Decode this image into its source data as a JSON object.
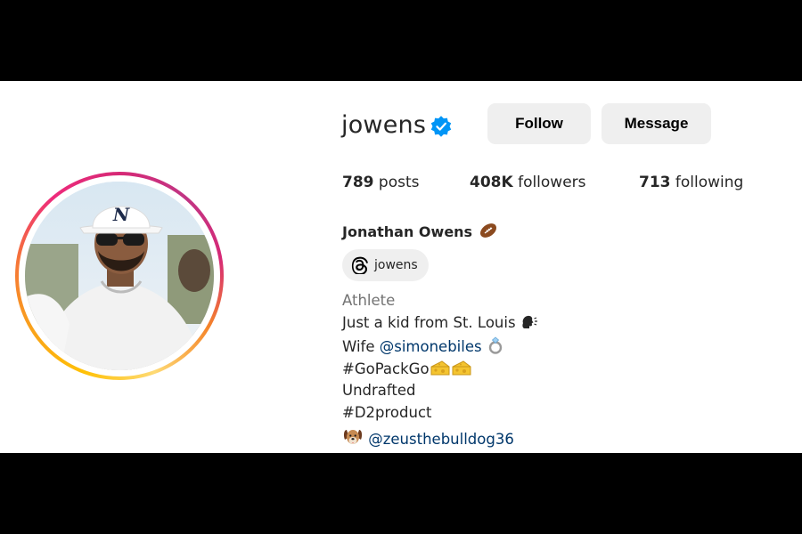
{
  "profile": {
    "username": "jowens",
    "verified": true,
    "full_name": "Jonathan Owens",
    "full_name_emoji": "american-football-icon",
    "category": "Athlete"
  },
  "actions": {
    "follow_label": "Follow",
    "message_label": "Message"
  },
  "stats": {
    "posts_num": "789",
    "posts_label": "posts",
    "followers_num": "408K",
    "followers_label": "followers",
    "following_num": "713",
    "following_label": "following"
  },
  "threads": {
    "handle": "jowens",
    "icon": "threads-icon"
  },
  "bio": {
    "line1": "Just a kid from St. Louis",
    "line1_emoji": "speaking-head-icon",
    "line2_prefix": "Wife ",
    "line2_mention": "@simonebiles",
    "line2_emoji": "ring-icon",
    "line3_text": "#GoPackGo",
    "line3_emoji": "cheese-icon",
    "line4": "Undrafted",
    "line5": "#D2product",
    "line6_emoji": "dog-icon",
    "line6_mention": "@zeusthebulldog36"
  },
  "colors": {
    "verified_blue": "#0095f6",
    "mention_blue": "#00376b",
    "button_gray": "#efefef",
    "secondary_text": "#737373"
  }
}
